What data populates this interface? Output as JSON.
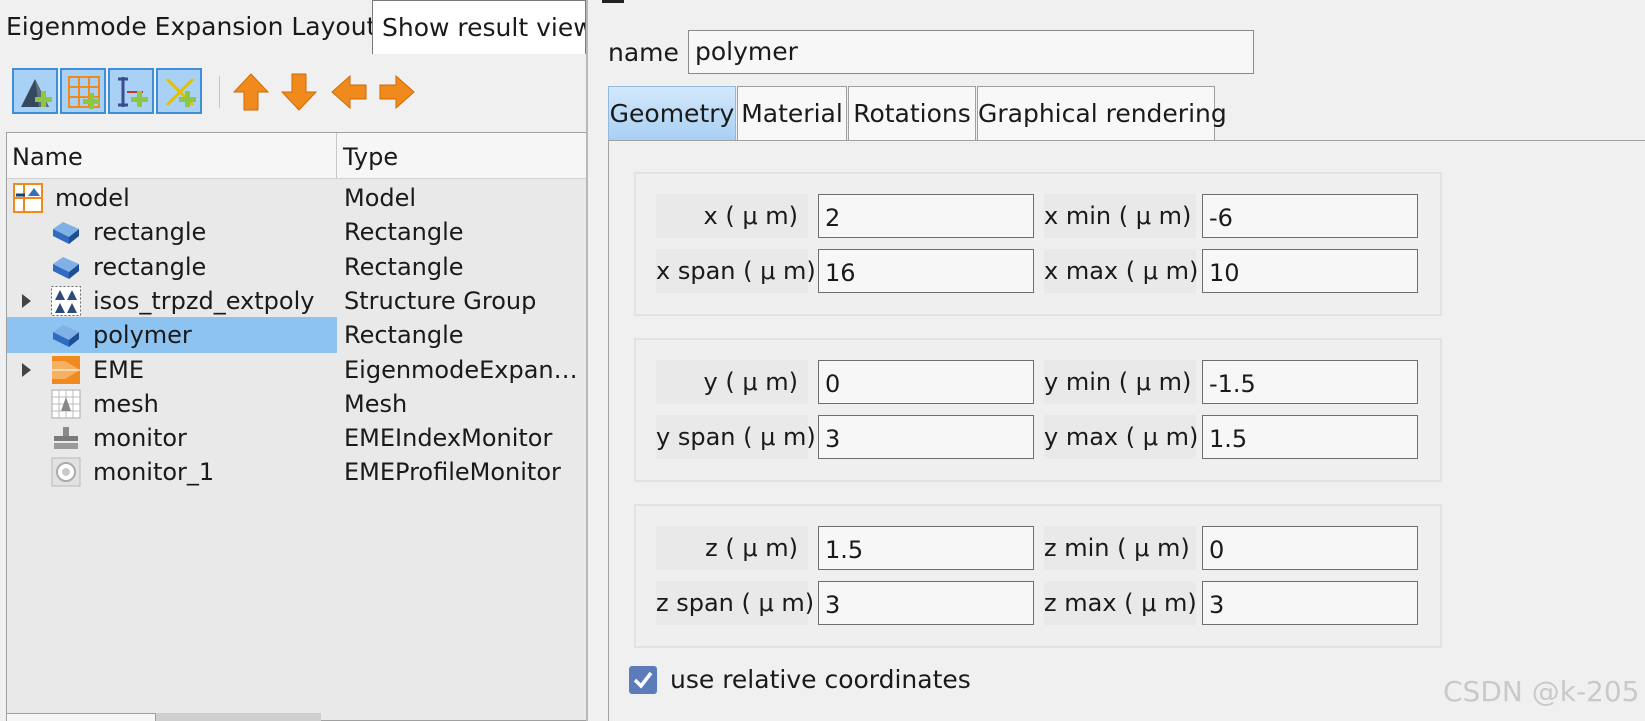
{
  "layout_panel": {
    "title": "Eigenmode Expansion Layout",
    "result_view_button": "Show result view",
    "toolbar": {
      "buttons": [
        {
          "icon": "add-structure-icon",
          "selected": true
        },
        {
          "icon": "add-mesh-icon",
          "selected": true
        },
        {
          "icon": "add-monitor-icon",
          "selected": true
        },
        {
          "icon": "add-source-icon",
          "selected": true
        },
        {
          "icon": "move-up-arrow-icon",
          "color": "#f08a1c"
        },
        {
          "icon": "move-down-arrow-icon",
          "color": "#f08a1c"
        },
        {
          "icon": "move-left-arrow-icon",
          "color": "#f08a1c"
        },
        {
          "icon": "move-right-arrow-icon",
          "color": "#f08a1c"
        }
      ]
    },
    "tree": {
      "columns": [
        "Name",
        "Type"
      ],
      "rows": [
        {
          "name": "model",
          "type": "Model",
          "icon": "model-icon",
          "indent": 0,
          "expandable": false,
          "selected": false
        },
        {
          "name": "rectangle",
          "type": "Rectangle",
          "icon": "rectangle-icon",
          "indent": 1,
          "expandable": false,
          "selected": false
        },
        {
          "name": "rectangle",
          "type": "Rectangle",
          "icon": "rectangle-icon",
          "indent": 1,
          "expandable": false,
          "selected": false
        },
        {
          "name": "isos_trpzd_extpoly",
          "type": "Structure Group",
          "icon": "structure-group-icon",
          "indent": 1,
          "expandable": true,
          "selected": false
        },
        {
          "name": "polymer",
          "type": "Rectangle",
          "icon": "rectangle-icon",
          "indent": 1,
          "expandable": false,
          "selected": true
        },
        {
          "name": "EME",
          "type": "EigenmodeExpan…",
          "icon": "eme-solver-icon",
          "indent": 1,
          "expandable": true,
          "selected": false
        },
        {
          "name": "mesh",
          "type": "Mesh",
          "icon": "mesh-icon",
          "indent": 1,
          "expandable": false,
          "selected": false
        },
        {
          "name": "monitor",
          "type": "EMEIndexMonitor",
          "icon": "index-monitor-icon",
          "indent": 1,
          "expandable": false,
          "selected": false
        },
        {
          "name": "monitor_1",
          "type": "EMEProfileMonitor",
          "icon": "profile-monitor-icon",
          "indent": 1,
          "expandable": false,
          "selected": false
        }
      ]
    }
  },
  "properties": {
    "name_label": "name",
    "name_value": "polymer",
    "tabs": [
      "Geometry",
      "Material",
      "Rotations",
      "Graphical rendering"
    ],
    "active_tab": "Geometry",
    "groups": [
      {
        "fields": [
          {
            "label": "x ( μ m)",
            "value": "2"
          },
          {
            "label": "x min ( μ m)",
            "value": "-6"
          },
          {
            "label": "x span ( μ m)",
            "value": "16"
          },
          {
            "label": "x max ( μ m)",
            "value": "10"
          }
        ]
      },
      {
        "fields": [
          {
            "label": "y ( μ m)",
            "value": "0"
          },
          {
            "label": "y min ( μ m)",
            "value": "-1.5"
          },
          {
            "label": "y span ( μ m)",
            "value": "3"
          },
          {
            "label": "y max ( μ m)",
            "value": "1.5"
          }
        ]
      },
      {
        "fields": [
          {
            "label": "z ( μ m)",
            "value": "1.5"
          },
          {
            "label": "z min ( μ m)",
            "value": "0"
          },
          {
            "label": "z span ( μ m)",
            "value": "3"
          },
          {
            "label": "z max ( μ m)",
            "value": "3"
          }
        ]
      }
    ],
    "relative_coordinates": {
      "label": "use relative coordinates",
      "checked": true
    }
  },
  "watermark": "CSDN @k-205",
  "colors": {
    "selection": "#8cc3f1",
    "tab_active": "#a8d0f3",
    "toolbar_selected": "#a9d1f5",
    "checkbox": "#5b7cb8"
  }
}
